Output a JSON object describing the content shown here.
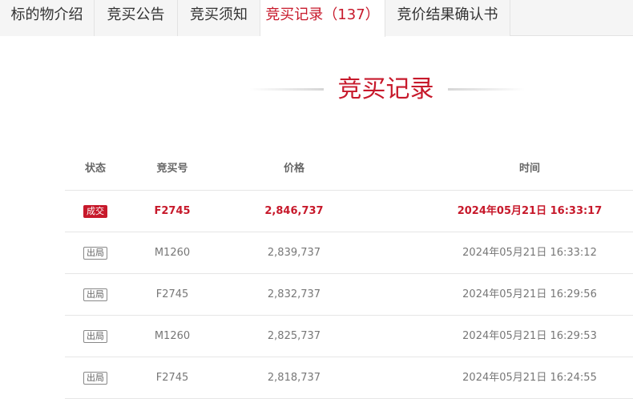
{
  "tabs": [
    {
      "label": "标的物介绍"
    },
    {
      "label": "竞买公告"
    },
    {
      "label": "竞买须知"
    },
    {
      "label": "竞买记录",
      "count": "（137）"
    },
    {
      "label": "竞价结果确认书"
    }
  ],
  "section_title": "竞买记录",
  "table": {
    "headers": {
      "status": "状态",
      "bid_no": "竞买号",
      "price": "价格",
      "time": "时间"
    },
    "rows": [
      {
        "status": "成交",
        "bid_no": "F2745",
        "price": "2,846,737",
        "time": "2024年05月21日 16:33:17"
      },
      {
        "status": "出局",
        "bid_no": "M1260",
        "price": "2,839,737",
        "time": "2024年05月21日 16:33:12"
      },
      {
        "status": "出局",
        "bid_no": "F2745",
        "price": "2,832,737",
        "time": "2024年05月21日 16:29:56"
      },
      {
        "status": "出局",
        "bid_no": "M1260",
        "price": "2,825,737",
        "time": "2024年05月21日 16:29:53"
      },
      {
        "status": "出局",
        "bid_no": "F2745",
        "price": "2,818,737",
        "time": "2024年05月21日 16:24:55"
      }
    ]
  },
  "colors": {
    "accent": "#c7192b",
    "tab_bg": "#f5f5f5",
    "border": "#e3e3e3"
  }
}
